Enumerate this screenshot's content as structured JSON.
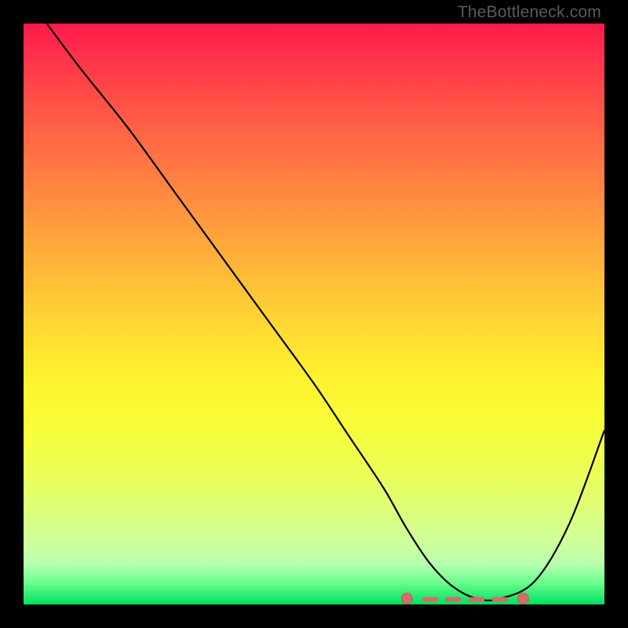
{
  "watermark": "TheBottleneck.com",
  "chart_data": {
    "type": "line",
    "title": "",
    "xlabel": "",
    "ylabel": "",
    "xlim": [
      0,
      100
    ],
    "ylim": [
      0,
      100
    ],
    "x": [
      4,
      10,
      18,
      26,
      34,
      42,
      50,
      56,
      62,
      66,
      70,
      74,
      78,
      82,
      88,
      94,
      100
    ],
    "values": [
      100,
      92,
      82,
      71,
      60,
      49,
      38,
      29,
      20,
      13,
      7,
      3,
      1,
      1,
      4,
      14,
      30
    ],
    "marker_region": {
      "x_start": 66,
      "x_end": 86,
      "y": 1
    }
  }
}
